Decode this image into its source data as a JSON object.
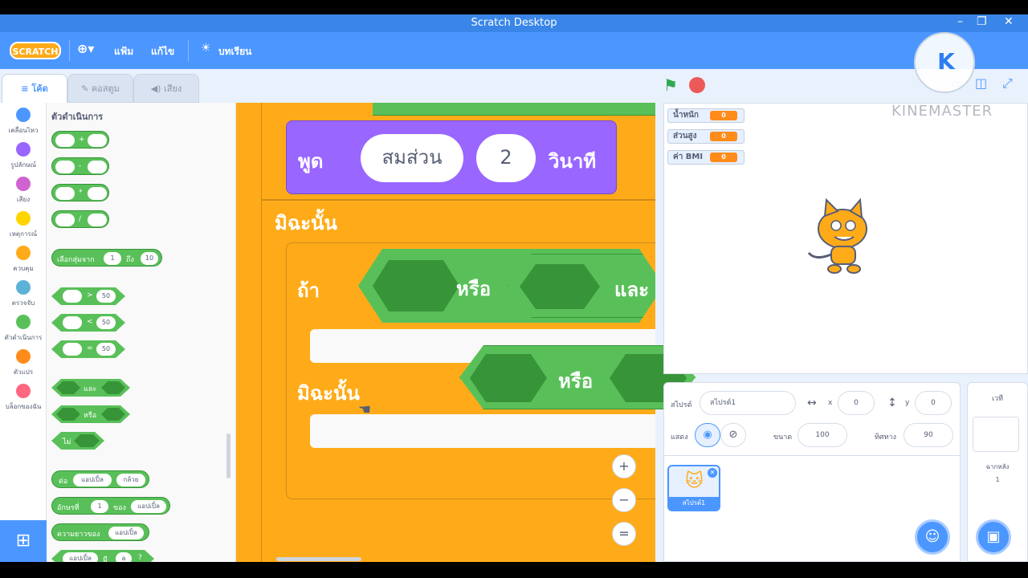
{
  "window": {
    "title": "Scratch Desktop",
    "controls": [
      "–",
      "❐",
      "✕"
    ]
  },
  "menubar": {
    "logo": "SCRATCH",
    "language_icon": "globe-icon",
    "file": "แฟ้ม",
    "edit": "แก้ไข",
    "tutorials": "บทเรียน"
  },
  "tabs": {
    "code": "โค้ด",
    "costumes": "คอสตูม",
    "sounds": "เสียง"
  },
  "categories": [
    {
      "label": "เคลื่อนไหว",
      "color": "#4c97ff"
    },
    {
      "label": "รูปลักษณ์",
      "color": "#9966ff"
    },
    {
      "label": "เสียง",
      "color": "#cf63cf"
    },
    {
      "label": "เหตุการณ์",
      "color": "#ffd500"
    },
    {
      "label": "ควบคุม",
      "color": "#ffab19"
    },
    {
      "label": "ตรวจจับ",
      "color": "#5cb1d6"
    },
    {
      "label": "ตัวดำเนินการ",
      "color": "#59c059"
    },
    {
      "label": "ตัวแปร",
      "color": "#ff8c1a"
    },
    {
      "label": "บล็อกของฉัน",
      "color": "#ff6680"
    }
  ],
  "palette": {
    "title": "ตัวดำเนินการ",
    "ops": [
      "+",
      "-",
      "*",
      "/"
    ],
    "random": {
      "label": "เลือกสุ่มจาก",
      "from": "1",
      "to_label": "ถึง",
      "to": "10"
    },
    "compare": [
      {
        "op": ">",
        "val": "50"
      },
      {
        "op": "<",
        "val": "50"
      },
      {
        "op": "=",
        "val": "50"
      }
    ],
    "and": "และ",
    "or": "หรือ",
    "not": "ไม่",
    "join": {
      "label": "ต่อ",
      "a": "แอปเปิ้ล",
      "b": "กล้วย"
    },
    "letter": {
      "label": "อักษรที่",
      "n": "1",
      "of": "ของ",
      "word": "แอปเปิ้ล"
    },
    "length": {
      "label": "ความยาวของ",
      "word": "แอปเปิ้ล"
    },
    "contains": {
      "word": "แอปเปิ้ล",
      "mid": "มี",
      "letter": "a",
      "q": "?"
    }
  },
  "script": {
    "say": {
      "label": "พูด",
      "text": "สมส่วน",
      "secs": "2",
      "unit": "วินาที"
    },
    "else1": "มิฉะนั้น",
    "if": "ถ้า",
    "or": "หรือ",
    "and": "และ",
    "else2": "มิฉะนั้น",
    "dragged_or": "หรือ",
    "zoom_in": "+",
    "zoom_out": "−",
    "zoom_reset": "="
  },
  "stage": {
    "monitors": [
      {
        "label": "น้ำหนัก",
        "value": "0"
      },
      {
        "label": "ส่วนสูง",
        "value": "0"
      },
      {
        "label": "ค่า BMI",
        "value": "0"
      }
    ],
    "watermark": "KINEMASTER"
  },
  "sprite_info": {
    "sprite_label": "สไปรต์",
    "sprite_name": "สไปรต์1",
    "x_label": "x",
    "x": "0",
    "y_label": "y",
    "y": "0",
    "show_label": "แสดง",
    "size_label": "ขนาด",
    "size": "100",
    "direction_label": "ทิศทาง",
    "direction": "90",
    "thumb_label": "สไปรต์1"
  },
  "stage_pane": {
    "title": "เวที",
    "backdrops_label": "ฉากหลัง",
    "backdrops_count": "1"
  },
  "colors": {
    "scratch_blue": "#4c97ff",
    "control_orange": "#ffab19",
    "operator_green": "#59c059",
    "looks_purple": "#9966ff"
  }
}
